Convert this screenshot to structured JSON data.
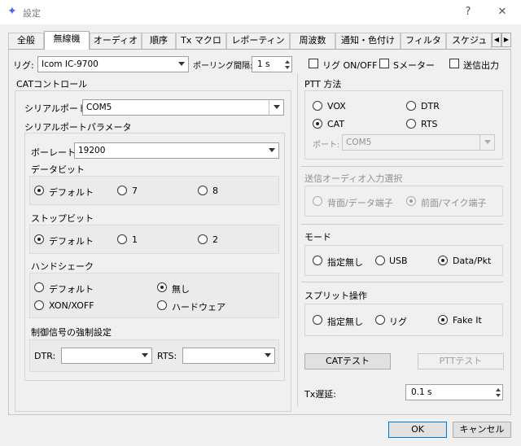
{
  "window": {
    "title": "設定",
    "help": "?",
    "close": "✕"
  },
  "tabs": [
    "全般",
    "無線機",
    "オーディオ",
    "順序",
    "Tx マクロ",
    "レポーティング",
    "周波数",
    "通知・色付け",
    "フィルタ",
    "スケジューリ"
  ],
  "rig": {
    "label": "リグ:",
    "value": "Icom IC-9700",
    "poll_label": "ポーリング間隔:",
    "poll_value": "1 s",
    "rig_onoff": "リグ ON/OFF",
    "smeter": "Sメーター",
    "tx_output": "送信出力"
  },
  "cat": {
    "title": "CATコントロール",
    "serial_port_label": "シリアルポート:",
    "serial_port_value": "COM5",
    "serial_params": "シリアルポートパラメータ",
    "baud_label": "ボーレート:",
    "baud_value": "19200",
    "data_bits": {
      "title": "データビット",
      "options": [
        "デフォルト",
        "7",
        "8"
      ]
    },
    "stop_bits": {
      "title": "ストップビット",
      "options": [
        "デフォルト",
        "1",
        "2"
      ]
    },
    "handshake": {
      "title": "ハンドシェーク",
      "options": [
        "デフォルト",
        "無し",
        "XON/XOFF",
        "ハードウェア"
      ]
    },
    "force": {
      "title": "制御信号の強制設定",
      "dtr_label": "DTR:",
      "rts_label": "RTS:"
    }
  },
  "ptt": {
    "title": "PTT 方法",
    "options": [
      "VOX",
      "DTR",
      "CAT",
      "RTS"
    ],
    "port_label": "ポート:",
    "port_value": "COM5"
  },
  "audio_input": {
    "title": "送信オーディオ入力選択",
    "options": [
      "背面/データ端子",
      "前面/マイク端子"
    ]
  },
  "mode": {
    "title": "モード",
    "options": [
      "指定無し",
      "USB",
      "Data/Pkt"
    ]
  },
  "split": {
    "title": "スプリット操作",
    "options": [
      "指定無し",
      "リグ",
      "Fake It"
    ]
  },
  "buttons": {
    "cat_test": "CATテスト",
    "ptt_test": "PTTテスト",
    "ok": "OK",
    "cancel": "キャンセル"
  },
  "tx_delay": {
    "label": "Tx遅延:",
    "value": "0.1 s"
  }
}
